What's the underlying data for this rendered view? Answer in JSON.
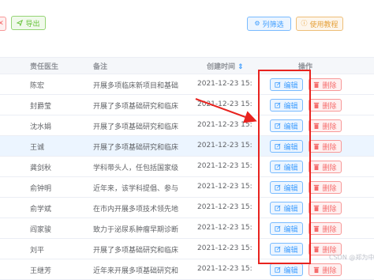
{
  "toolbar": {
    "partial_left_icon": "✕",
    "export_icon": "send-icon",
    "export_label": "导出",
    "columns_icon": "gear-icon",
    "columns_label": "列筛选",
    "tutorial_icon": "info-circle-icon",
    "tutorial_label": "使用教程"
  },
  "table": {
    "headers": {
      "doctor": "责任医生",
      "note": "备注",
      "created": "创建时间",
      "action": "操作"
    },
    "sort_icon": "sort-icon",
    "edit_label": "编辑",
    "delete_label": "删除",
    "edit_icon": "edit-icon",
    "delete_icon": "trash-icon",
    "rows": [
      {
        "doctor": "陈宏",
        "note": "开展多项临床新项目和基础...",
        "created": "2021-12-23 15:2"
      },
      {
        "doctor": "封爵莹",
        "note": "开展了多项基础研究和临床...",
        "created": "2021-12-23 15:2"
      },
      {
        "doctor": "沈水娟",
        "note": "开展了多项基础研究和临床...",
        "created": "2021-12-23 15:2"
      },
      {
        "doctor": "王诚",
        "note": "开展了多项基础研究和临床...",
        "created": "2021-12-23 15:2"
      },
      {
        "doctor": "龚剑秋",
        "note": "学科带头人，任包括国家级委...",
        "created": "2021-12-23 15:2"
      },
      {
        "doctor": "俞钟明",
        "note": "近年来，该学科提倡、参与...",
        "created": "2021-12-23 15:2"
      },
      {
        "doctor": "俞学斌",
        "note": "在市内开展多项技术领先地...",
        "created": "2021-12-23 15:2"
      },
      {
        "doctor": "阎家骏",
        "note": "致力于泌尿系肿瘤早期诊断...",
        "created": "2021-12-23 15:2"
      },
      {
        "doctor": "刘平",
        "note": "开展了多项基础研究和临床...",
        "created": "2021-12-23 15:2"
      },
      {
        "doctor": "王继芳",
        "note": "近年来开展多项基础研究和...",
        "created": "2021-12-23 15:2"
      }
    ]
  },
  "annotation": {
    "color": "#e8231f"
  },
  "watermark": "CSDN @郑为中",
  "colors": {
    "primary": "#409eff",
    "danger": "#f56c6c",
    "success": "#67c23a",
    "warning": "#e6a23c"
  }
}
